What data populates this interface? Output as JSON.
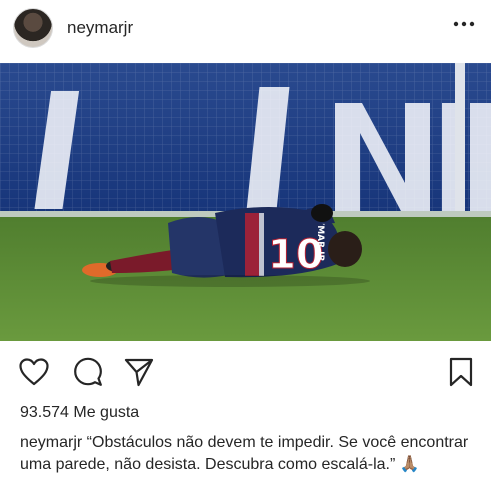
{
  "post": {
    "username": "neymarjr",
    "more_icon": "more-options-icon",
    "likes": "93.574 Me gusta",
    "caption_user": "neymarjr",
    "caption_text": " “Obstáculos não devem te impedir. Se você encontrar uma parede, não desista. Descubra como escalá-la.” ",
    "caption_emoji": "🙏🏽"
  },
  "photo": {
    "jersey_number": "10",
    "jersey_name": "NEYMAR JR",
    "banner_text": "N NI"
  },
  "actions": {
    "like": "heart-icon",
    "comment": "comment-bubble-icon",
    "share": "paper-plane-icon",
    "save": "bookmark-icon"
  },
  "colors": {
    "text": "#262626",
    "pitch": "#5a8a36",
    "stand": "#1d3f86",
    "jersey": "#1c2a5a"
  }
}
